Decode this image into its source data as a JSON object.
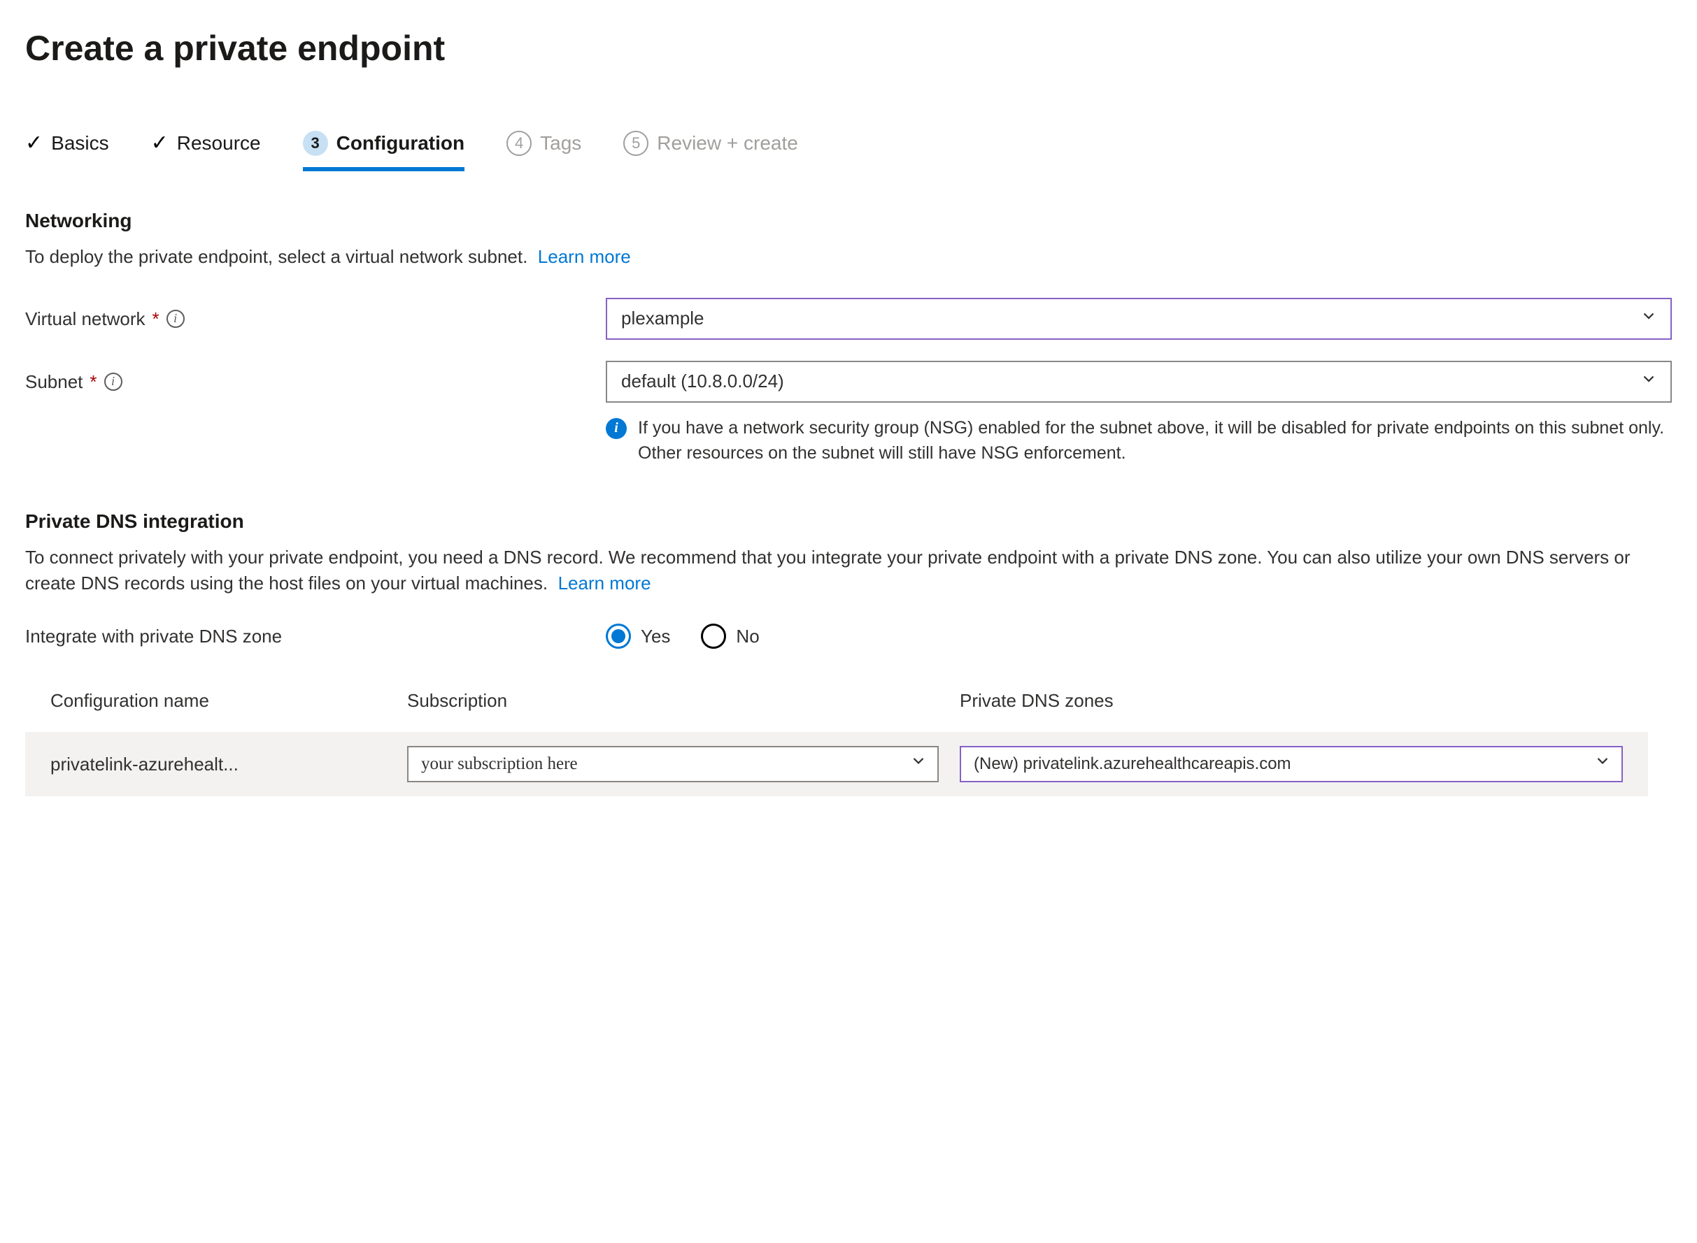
{
  "page_title": "Create a private endpoint",
  "steps": [
    {
      "label": "Basics",
      "state": "done"
    },
    {
      "label": "Resource",
      "state": "done"
    },
    {
      "label": "Configuration",
      "state": "active",
      "num": "3"
    },
    {
      "label": "Tags",
      "state": "future",
      "num": "4"
    },
    {
      "label": "Review + create",
      "state": "future",
      "num": "5"
    }
  ],
  "networking": {
    "heading": "Networking",
    "description": "To deploy the private endpoint, select a virtual network subnet.",
    "learn_more": "Learn more",
    "virtual_network_label": "Virtual network",
    "virtual_network_value": "plexample",
    "subnet_label": "Subnet",
    "subnet_value": "default (10.8.0.0/24)",
    "subnet_info": "If you have a network security group (NSG) enabled for the subnet above, it will be disabled for private endpoints on this subnet only. Other resources on the subnet will still have NSG enforcement."
  },
  "dns": {
    "heading": "Private DNS integration",
    "description": "To connect privately with your private endpoint, you need a DNS record. We recommend that you integrate your private endpoint with a private DNS zone. You can also utilize your own DNS servers or create DNS records using the host files on your virtual machines.",
    "learn_more": "Learn more",
    "integrate_label": "Integrate with private DNS zone",
    "options": {
      "yes": "Yes",
      "no": "No",
      "selected": "yes"
    },
    "table": {
      "col_config_name": "Configuration name",
      "col_subscription": "Subscription",
      "col_zones": "Private DNS zones",
      "row": {
        "config_name": "privatelink-azurehealt...",
        "subscription_value": "your subscription here",
        "zones_value": "(New) privatelink.azurehealthcareapis.com"
      }
    }
  }
}
